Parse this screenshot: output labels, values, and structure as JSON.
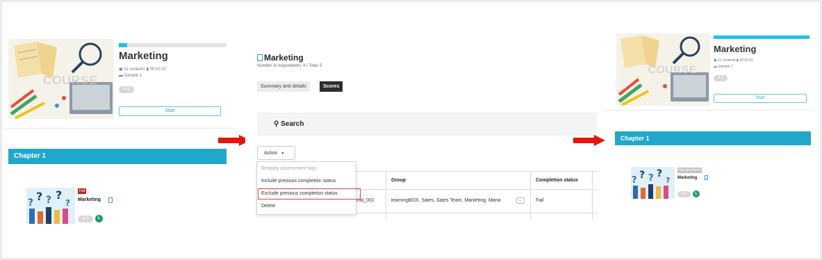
{
  "left": {
    "course_image_word": "COURSE",
    "title": "Marketing",
    "progress": 0.08,
    "contents": "11 contents",
    "duration": "00:02:31",
    "sample": "Sample 1",
    "likes": "0",
    "start_label": "Start",
    "chapter_label": "Chapter 1",
    "item_status": "Fail",
    "item_title": "Marketing",
    "item_likes": "0",
    "icon_letter": "L"
  },
  "middle": {
    "title": "Marketing",
    "subtitle": "Number of respondents: 4 / Total: 5",
    "tabs": [
      "Summary and details",
      "Scores"
    ],
    "search_label": "Search",
    "action_label": "Action",
    "dropdown_items": [
      "Reapply assessment tags",
      "Include previous completion status",
      "Exclude previous completion status",
      "Delete"
    ],
    "table": {
      "headers": [
        "Group",
        "Completion status"
      ],
      "row": {
        "user_tail": "trial_001",
        "group": "learningBOX, Sales, Sales Team, Marketing, Mana",
        "status": "Fail"
      }
    }
  },
  "right": {
    "course_image_word": "COURSE",
    "title": "Marketing",
    "progress": 1.0,
    "contents": "11 contents",
    "duration": "00:02:31",
    "sample": "Sample 1",
    "likes": "0",
    "start_label": "Start",
    "chapter_label": "Chapter 1",
    "item_status": "Not attempted",
    "item_title": "Marketing",
    "item_likes": "0",
    "icon_letter": "L"
  },
  "colors": {
    "accent": "#1ec2ea",
    "chapter_bar": "#1fa8cc",
    "arrow": "#e8140c",
    "fail": "#c0261d",
    "not_attempted": "#bfc3c7",
    "highlight": "#e04040",
    "green_icon": "#1a9e6b"
  }
}
